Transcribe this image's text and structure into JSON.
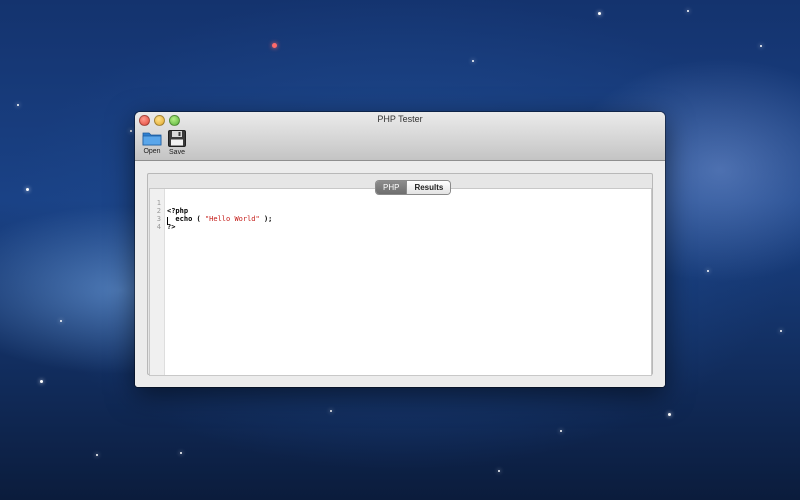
{
  "window": {
    "title": "PHP Tester"
  },
  "toolbar": {
    "open_label": "Open",
    "save_label": "Save"
  },
  "tabs": [
    {
      "label": "PHP",
      "active": true
    },
    {
      "label": "Results",
      "active": false
    }
  ],
  "editor": {
    "line_numbers": [
      "1",
      "2",
      "3",
      "4"
    ],
    "lines": {
      "l1": "<?php",
      "l2_prefix": "  echo ( ",
      "l2_string": "\"Hello World\"",
      "l2_suffix": " );",
      "l3": "?>",
      "l4": ""
    }
  },
  "colors": {
    "string": "#c41a16",
    "close": "#e2463a",
    "minimize": "#e0a92c",
    "zoom": "#57b33a"
  }
}
